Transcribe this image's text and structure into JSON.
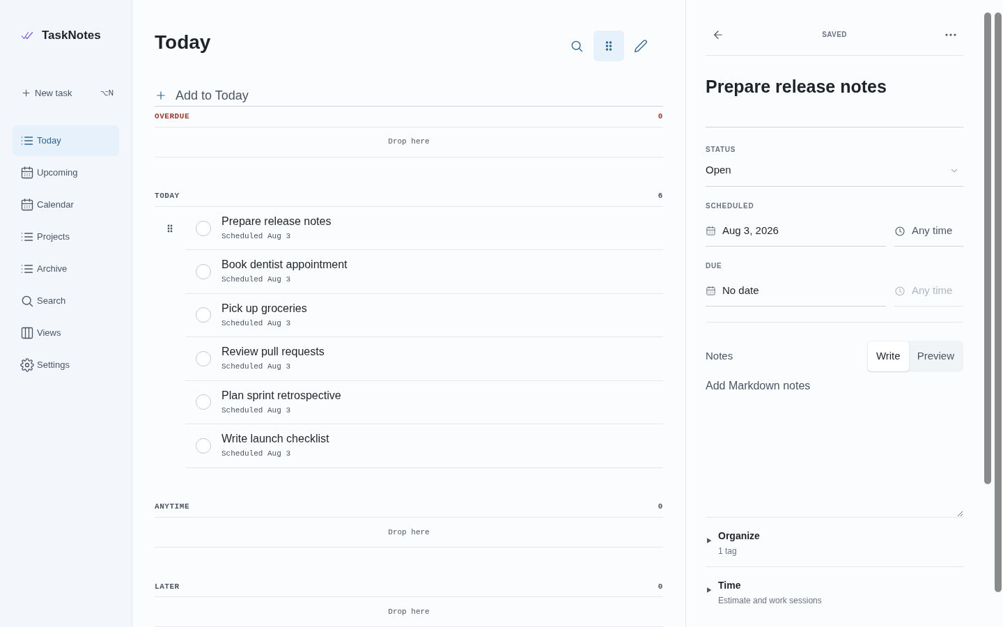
{
  "sidebar": {
    "app_name": "TaskNotes",
    "new_task": {
      "label": "New task",
      "shortcut": "⌥N"
    },
    "items": [
      {
        "label": "Today",
        "selected": true
      },
      {
        "label": "Upcoming",
        "selected": false
      },
      {
        "label": "Calendar",
        "selected": false
      },
      {
        "label": "Projects",
        "selected": false
      },
      {
        "label": "Archive",
        "selected": false
      },
      {
        "label": "Search",
        "selected": false
      },
      {
        "label": "Views",
        "selected": false
      },
      {
        "label": "Settings",
        "selected": false
      }
    ]
  },
  "main": {
    "title": "Today",
    "toolbar": [
      {
        "kind": "search",
        "selected": false
      },
      {
        "kind": "grid",
        "selected": true
      },
      {
        "kind": "edit",
        "selected": false
      }
    ],
    "add_task": {
      "placeholder": "Add to Today"
    },
    "sections": [
      {
        "label": "OVERDUE",
        "count": "0",
        "color": "#9a3b2e",
        "drop_text": "Drop here"
      },
      {
        "label": "TODAY",
        "count": "6",
        "color": "#4b5563",
        "tasks": [
          {
            "title": "Prepare release notes",
            "meta": "Scheduled Aug 3",
            "hovered": true,
            "checked": false
          },
          {
            "title": "Book dentist appointment",
            "meta": "Scheduled Aug 3",
            "hovered": false,
            "checked": false
          },
          {
            "title": "Pick up groceries",
            "meta": "Scheduled Aug 3",
            "hovered": false,
            "checked": false
          },
          {
            "title": "Review pull requests",
            "meta": "Scheduled Aug 3",
            "hovered": false,
            "checked": false
          },
          {
            "title": "Plan sprint retrospective",
            "meta": "Scheduled Aug 3",
            "hovered": false,
            "checked": false
          },
          {
            "title": "Write launch checklist",
            "meta": "Scheduled Aug 3",
            "hovered": false,
            "checked": false
          }
        ]
      },
      {
        "label": "ANYTIME",
        "count": "0",
        "color": "#4b5563",
        "drop_text": "Drop here"
      },
      {
        "label": "LATER",
        "count": "0",
        "color": "#4b5563",
        "drop_text": "Drop here"
      }
    ]
  },
  "detail": {
    "save_state": "SAVED",
    "title": "Prepare release notes",
    "status": {
      "label": "STATUS",
      "value": "Open"
    },
    "scheduled": {
      "label": "SCHEDULED",
      "date": "Aug 3, 2026",
      "time": "Any time",
      "time_disabled": false
    },
    "due": {
      "label": "DUE",
      "date": "No date",
      "time": "Any time",
      "time_disabled": true
    },
    "notes": {
      "label": "Notes",
      "tabs": [
        {
          "label": "Write",
          "selected": true
        },
        {
          "label": "Preview",
          "selected": false
        }
      ],
      "placeholder": "Add Markdown notes"
    },
    "groups": [
      {
        "title": "Organize",
        "subtitle": "1 tag",
        "expanded": false
      },
      {
        "title": "Time",
        "subtitle": "Estimate and work sessions",
        "expanded": false
      }
    ]
  }
}
